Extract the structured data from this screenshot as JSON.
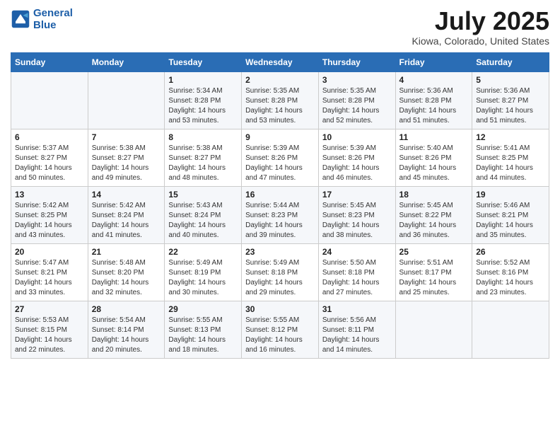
{
  "header": {
    "logo_line1": "General",
    "logo_line2": "Blue",
    "main_title": "July 2025",
    "subtitle": "Kiowa, Colorado, United States"
  },
  "days_of_week": [
    "Sunday",
    "Monday",
    "Tuesday",
    "Wednesday",
    "Thursday",
    "Friday",
    "Saturday"
  ],
  "weeks": [
    [
      {
        "day": "",
        "sunrise": "",
        "sunset": "",
        "daylight": ""
      },
      {
        "day": "",
        "sunrise": "",
        "sunset": "",
        "daylight": ""
      },
      {
        "day": "1",
        "sunrise": "Sunrise: 5:34 AM",
        "sunset": "Sunset: 8:28 PM",
        "daylight": "Daylight: 14 hours and 53 minutes."
      },
      {
        "day": "2",
        "sunrise": "Sunrise: 5:35 AM",
        "sunset": "Sunset: 8:28 PM",
        "daylight": "Daylight: 14 hours and 53 minutes."
      },
      {
        "day": "3",
        "sunrise": "Sunrise: 5:35 AM",
        "sunset": "Sunset: 8:28 PM",
        "daylight": "Daylight: 14 hours and 52 minutes."
      },
      {
        "day": "4",
        "sunrise": "Sunrise: 5:36 AM",
        "sunset": "Sunset: 8:28 PM",
        "daylight": "Daylight: 14 hours and 51 minutes."
      },
      {
        "day": "5",
        "sunrise": "Sunrise: 5:36 AM",
        "sunset": "Sunset: 8:27 PM",
        "daylight": "Daylight: 14 hours and 51 minutes."
      }
    ],
    [
      {
        "day": "6",
        "sunrise": "Sunrise: 5:37 AM",
        "sunset": "Sunset: 8:27 PM",
        "daylight": "Daylight: 14 hours and 50 minutes."
      },
      {
        "day": "7",
        "sunrise": "Sunrise: 5:38 AM",
        "sunset": "Sunset: 8:27 PM",
        "daylight": "Daylight: 14 hours and 49 minutes."
      },
      {
        "day": "8",
        "sunrise": "Sunrise: 5:38 AM",
        "sunset": "Sunset: 8:27 PM",
        "daylight": "Daylight: 14 hours and 48 minutes."
      },
      {
        "day": "9",
        "sunrise": "Sunrise: 5:39 AM",
        "sunset": "Sunset: 8:26 PM",
        "daylight": "Daylight: 14 hours and 47 minutes."
      },
      {
        "day": "10",
        "sunrise": "Sunrise: 5:39 AM",
        "sunset": "Sunset: 8:26 PM",
        "daylight": "Daylight: 14 hours and 46 minutes."
      },
      {
        "day": "11",
        "sunrise": "Sunrise: 5:40 AM",
        "sunset": "Sunset: 8:26 PM",
        "daylight": "Daylight: 14 hours and 45 minutes."
      },
      {
        "day": "12",
        "sunrise": "Sunrise: 5:41 AM",
        "sunset": "Sunset: 8:25 PM",
        "daylight": "Daylight: 14 hours and 44 minutes."
      }
    ],
    [
      {
        "day": "13",
        "sunrise": "Sunrise: 5:42 AM",
        "sunset": "Sunset: 8:25 PM",
        "daylight": "Daylight: 14 hours and 43 minutes."
      },
      {
        "day": "14",
        "sunrise": "Sunrise: 5:42 AM",
        "sunset": "Sunset: 8:24 PM",
        "daylight": "Daylight: 14 hours and 41 minutes."
      },
      {
        "day": "15",
        "sunrise": "Sunrise: 5:43 AM",
        "sunset": "Sunset: 8:24 PM",
        "daylight": "Daylight: 14 hours and 40 minutes."
      },
      {
        "day": "16",
        "sunrise": "Sunrise: 5:44 AM",
        "sunset": "Sunset: 8:23 PM",
        "daylight": "Daylight: 14 hours and 39 minutes."
      },
      {
        "day": "17",
        "sunrise": "Sunrise: 5:45 AM",
        "sunset": "Sunset: 8:23 PM",
        "daylight": "Daylight: 14 hours and 38 minutes."
      },
      {
        "day": "18",
        "sunrise": "Sunrise: 5:45 AM",
        "sunset": "Sunset: 8:22 PM",
        "daylight": "Daylight: 14 hours and 36 minutes."
      },
      {
        "day": "19",
        "sunrise": "Sunrise: 5:46 AM",
        "sunset": "Sunset: 8:21 PM",
        "daylight": "Daylight: 14 hours and 35 minutes."
      }
    ],
    [
      {
        "day": "20",
        "sunrise": "Sunrise: 5:47 AM",
        "sunset": "Sunset: 8:21 PM",
        "daylight": "Daylight: 14 hours and 33 minutes."
      },
      {
        "day": "21",
        "sunrise": "Sunrise: 5:48 AM",
        "sunset": "Sunset: 8:20 PM",
        "daylight": "Daylight: 14 hours and 32 minutes."
      },
      {
        "day": "22",
        "sunrise": "Sunrise: 5:49 AM",
        "sunset": "Sunset: 8:19 PM",
        "daylight": "Daylight: 14 hours and 30 minutes."
      },
      {
        "day": "23",
        "sunrise": "Sunrise: 5:49 AM",
        "sunset": "Sunset: 8:18 PM",
        "daylight": "Daylight: 14 hours and 29 minutes."
      },
      {
        "day": "24",
        "sunrise": "Sunrise: 5:50 AM",
        "sunset": "Sunset: 8:18 PM",
        "daylight": "Daylight: 14 hours and 27 minutes."
      },
      {
        "day": "25",
        "sunrise": "Sunrise: 5:51 AM",
        "sunset": "Sunset: 8:17 PM",
        "daylight": "Daylight: 14 hours and 25 minutes."
      },
      {
        "day": "26",
        "sunrise": "Sunrise: 5:52 AM",
        "sunset": "Sunset: 8:16 PM",
        "daylight": "Daylight: 14 hours and 23 minutes."
      }
    ],
    [
      {
        "day": "27",
        "sunrise": "Sunrise: 5:53 AM",
        "sunset": "Sunset: 8:15 PM",
        "daylight": "Daylight: 14 hours and 22 minutes."
      },
      {
        "day": "28",
        "sunrise": "Sunrise: 5:54 AM",
        "sunset": "Sunset: 8:14 PM",
        "daylight": "Daylight: 14 hours and 20 minutes."
      },
      {
        "day": "29",
        "sunrise": "Sunrise: 5:55 AM",
        "sunset": "Sunset: 8:13 PM",
        "daylight": "Daylight: 14 hours and 18 minutes."
      },
      {
        "day": "30",
        "sunrise": "Sunrise: 5:55 AM",
        "sunset": "Sunset: 8:12 PM",
        "daylight": "Daylight: 14 hours and 16 minutes."
      },
      {
        "day": "31",
        "sunrise": "Sunrise: 5:56 AM",
        "sunset": "Sunset: 8:11 PM",
        "daylight": "Daylight: 14 hours and 14 minutes."
      },
      {
        "day": "",
        "sunrise": "",
        "sunset": "",
        "daylight": ""
      },
      {
        "day": "",
        "sunrise": "",
        "sunset": "",
        "daylight": ""
      }
    ]
  ]
}
